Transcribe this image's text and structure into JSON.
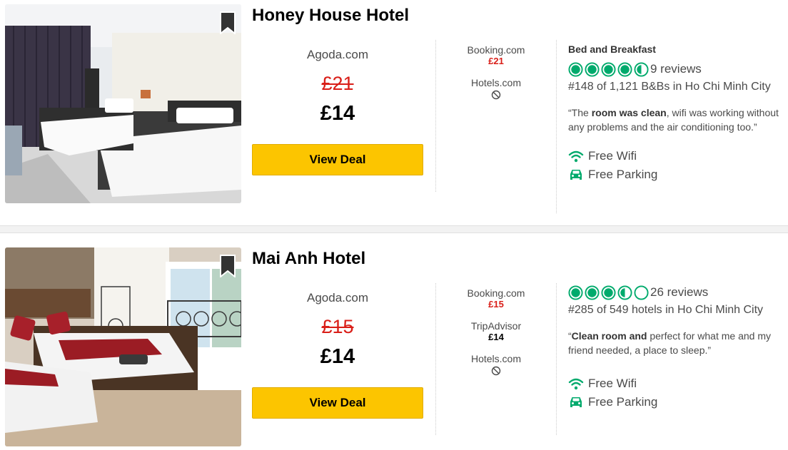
{
  "colors": {
    "deal_button": "#fcc500",
    "strike_price": "#d91e18",
    "rating_green": "#00aa6c"
  },
  "hotels": [
    {
      "name": "Honey House Hotel",
      "featured_provider": "Agoda.com",
      "old_price": "£21",
      "price": "£14",
      "deal_label": "View Deal",
      "bookmark_icon": "bookmark-icon",
      "providers": [
        {
          "name": "Booking.com",
          "price": "£21",
          "price_style": "red"
        },
        {
          "name": "Hotels.com",
          "price": null,
          "icon": "unavailable-icon"
        }
      ],
      "property_type": "Bed and Breakfast",
      "rating": 4.5,
      "reviews": "9 reviews",
      "rank": "#148 of 1,121 B&Bs in Ho Chi Minh City",
      "quote": {
        "open": "“The ",
        "bold": "room was clean",
        "rest": ", wifi was working without any problems and the air conditioning too.”"
      },
      "amenities": [
        {
          "label": "Free Wifi",
          "icon": "wifi-icon"
        },
        {
          "label": "Free Parking",
          "icon": "car-icon"
        }
      ]
    },
    {
      "name": "Mai Anh Hotel",
      "featured_provider": "Agoda.com",
      "old_price": "£15",
      "price": "£14",
      "deal_label": "View Deal",
      "bookmark_icon": "bookmark-icon",
      "providers": [
        {
          "name": "Booking.com",
          "price": "£15",
          "price_style": "red"
        },
        {
          "name": "TripAdvisor",
          "price": "£14",
          "price_style": "black"
        },
        {
          "name": "Hotels.com",
          "price": null,
          "icon": "unavailable-icon"
        }
      ],
      "property_type": "",
      "rating": 3.5,
      "reviews": "26 reviews",
      "rank": "#285 of 549 hotels in Ho Chi Minh City",
      "quote": {
        "open": "“",
        "bold": "Clean room and",
        "rest": " perfect for what me and my friend needed, a place to sleep.”"
      },
      "amenities": [
        {
          "label": "Free Wifi",
          "icon": "wifi-icon"
        },
        {
          "label": "Free Parking",
          "icon": "car-icon"
        }
      ]
    }
  ]
}
